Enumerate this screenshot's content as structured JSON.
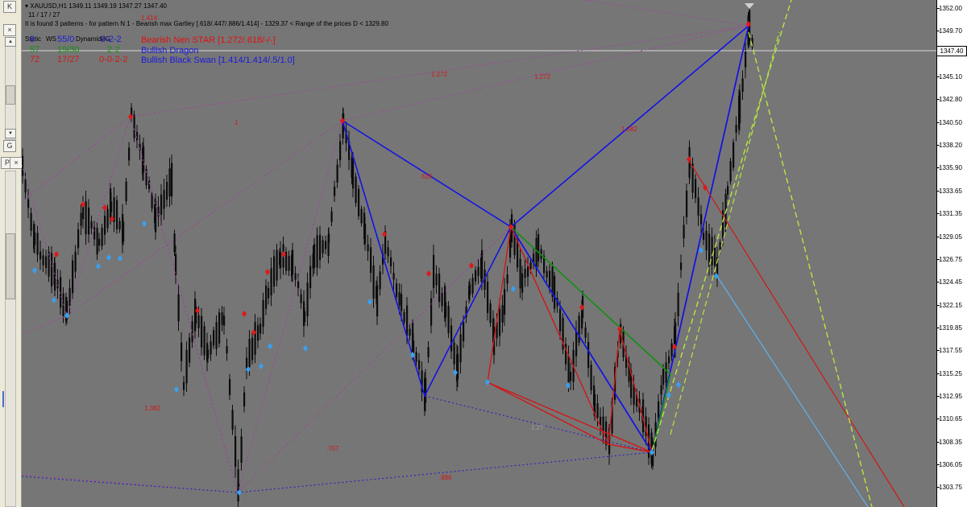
{
  "window": {
    "symbol_line": "XAUUSD,H1  1349.11 1349.19 1347.27 1347.40",
    "counter_line": "11 / 17 / 27",
    "status_line": "It is found 3 patterns  -  for pattern N 1 - Bearish max Gartley [.618/.447/.886/1.414] - 1329.37 < Range of the prices D < 1329.80"
  },
  "left_panel": {
    "btn_k": "K",
    "btn_x": "×",
    "btn_up": "▲",
    "btn_down": "▼",
    "btn_g": "G",
    "btn_p": "P",
    "btn_x2": "×"
  },
  "patterns_table": {
    "header_static": "Static",
    "header_ws": "WS",
    "header_dynamic": "Dynamic",
    "header_mg": "MG",
    "rows": [
      {
        "col1": "9",
        "col2": "55/0",
        "col3": "0-2-2",
        "name": "Bearish Nen STAR [1.272/.618/-/-]",
        "color": "#e01010"
      },
      {
        "col1": "57",
        "col2": "19/30",
        "col3": "2-2",
        "name": "Bullish Dragon",
        "color": "#1a1adc"
      },
      {
        "col1": "72",
        "col2": "17/27",
        "col3": "0-0-2-2",
        "name": "Bullish Black Swan [1.414/1.414/.5/1.0]",
        "color": "#1a1adc"
      }
    ]
  },
  "price_axis": {
    "current_price": "1347.40",
    "ticks": [
      "1352.00",
      "1349.70",
      "1347.40",
      "1345.10",
      "1342.80",
      "1340.50",
      "1338.20",
      "1335.90",
      "1333.65",
      "1331.35",
      "1329.05",
      "1326.75",
      "1324.45",
      "1322.15",
      "1319.85",
      "1317.55",
      "1315.25",
      "1312.95",
      "1310.65",
      "1308.35",
      "1306.05",
      "1303.75"
    ]
  },
  "chart_labels": {
    "ratio_top": "1.272",
    "ratio_top2": "1.272",
    "ratio_1": "1",
    "ratio_618": ".618",
    "ratio_1382": "1.382",
    "ratio_low_left": "1.382",
    "ratio_707": ".707",
    "ratio_886": ".886",
    "ratio_mid": "1.27",
    "ratio_top_left": "1.414"
  },
  "colors": {
    "chart_bg": "#767676",
    "blue_pattern": "#1414e6",
    "red_pattern": "#d01818",
    "green_pattern": "#109010",
    "zigzag": "#a040a0",
    "lime_dashed": "#b8e640",
    "sky_line": "#5ab4f0",
    "candle": "#0c0c0c"
  }
}
